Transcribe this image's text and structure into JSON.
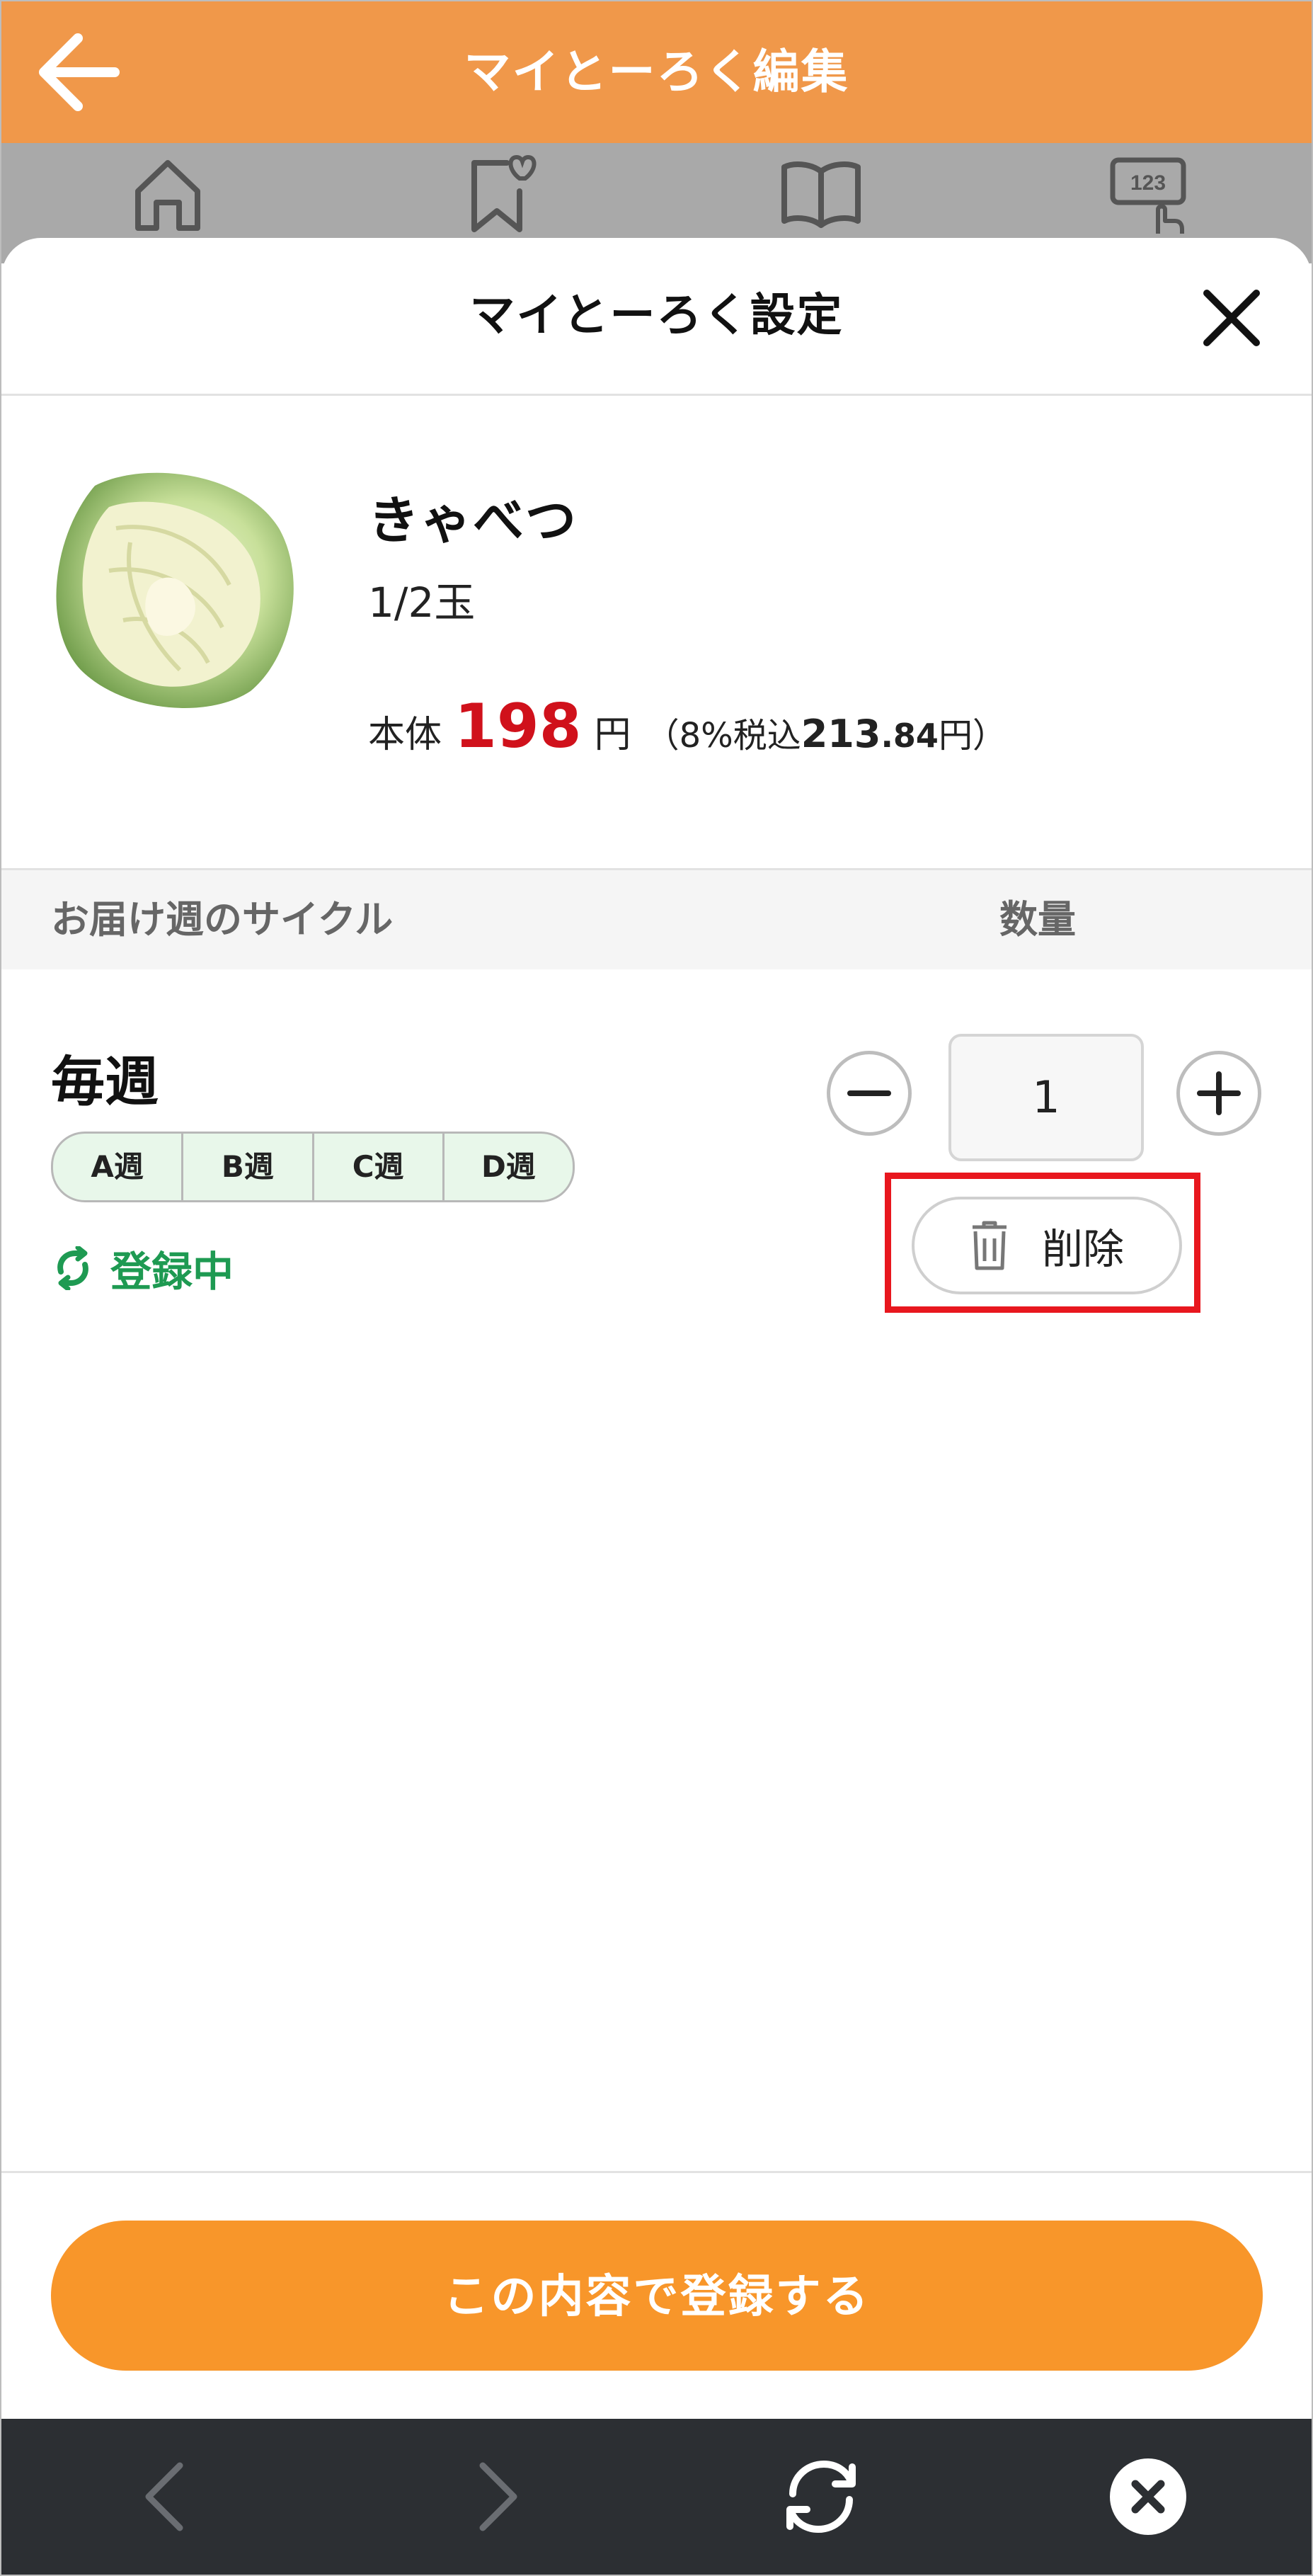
{
  "appbar": {
    "title": "マイとーろく編集",
    "back_icon": "arrow-left-icon",
    "color": "#f0984a"
  },
  "nav_tabs": [
    {
      "icon": "home-icon"
    },
    {
      "icon": "bookmark-heart-icon"
    },
    {
      "icon": "book-icon"
    },
    {
      "icon": "number-input-icon",
      "glyph": "123"
    }
  ],
  "sheet": {
    "title": "マイとーろく設定",
    "close_icon": "close-icon"
  },
  "product": {
    "name": "きゃべつ",
    "size": "1/2玉",
    "price_label": "本体",
    "price": "198",
    "price_unit": "円",
    "tax_prefix": "（8%税込",
    "tax_price_int": "213",
    "tax_price_dec": ".84",
    "tax_suffix": "円）",
    "price_color": "#d0111b"
  },
  "section": {
    "cycle_header": "お届け週のサイクル",
    "qty_header": "数量"
  },
  "schedule": {
    "title": "毎週",
    "weeks": [
      "A週",
      "B週",
      "C週",
      "D週"
    ],
    "status": "登録中",
    "status_color": "#1e9a52"
  },
  "quantity": {
    "value": "1"
  },
  "delete": {
    "label": "削除",
    "highlight_color": "#e8171e"
  },
  "footer": {
    "submit_label": "この内容で登録する",
    "submit_color": "#f8962a"
  },
  "browser": {
    "icons": [
      "chevron-left-icon",
      "chevron-right-icon",
      "refresh-icon",
      "close-circle-icon"
    ],
    "background": "#2c2f33"
  }
}
